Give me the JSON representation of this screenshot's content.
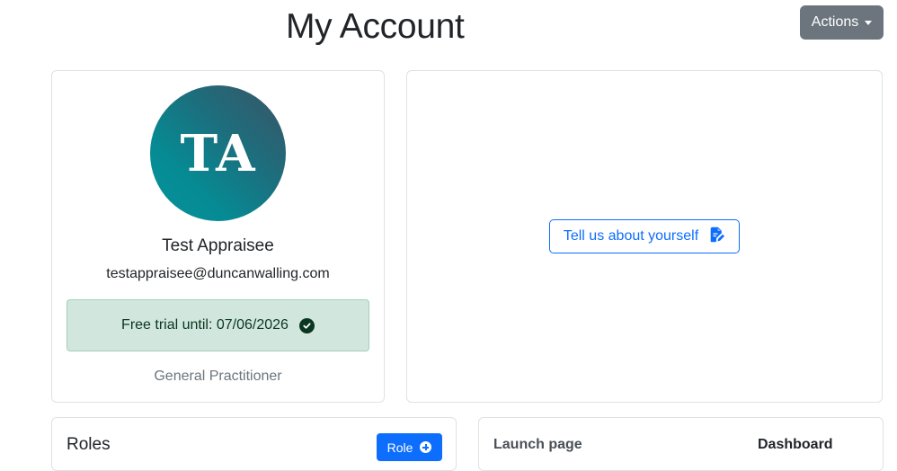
{
  "header": {
    "title": "My Account",
    "actions_label": "Actions"
  },
  "profile": {
    "initials": "TA",
    "name": "Test Appraisee",
    "email": "testappraisee@duncanwalling.com",
    "trial_text": "Free trial until: 07/06/2026",
    "profession": "General Practitioner"
  },
  "about": {
    "button_label": "Tell us about yourself",
    "icon": "file-pen-icon"
  },
  "roles": {
    "title": "Roles",
    "add_label": "Role"
  },
  "launch": {
    "label": "Launch page",
    "value": "Dashboard"
  },
  "colors": {
    "primary": "#0d6efd",
    "secondary": "#6c757d",
    "success_bg": "#d1e7dd",
    "success_text": "#0a3622"
  }
}
